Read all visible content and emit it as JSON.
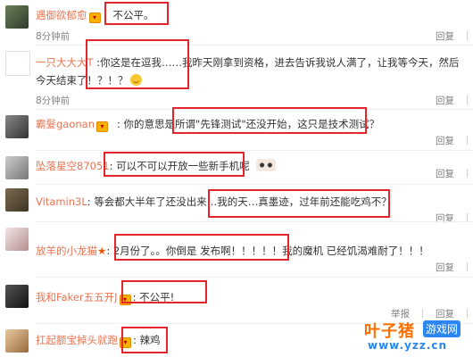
{
  "comments": [
    {
      "user": "遇御欲郁愈",
      "text": "不公平。",
      "time": "8分钟前",
      "actions": [
        "回复"
      ]
    },
    {
      "user": "一只大大大T",
      "text": "你这是在逗我……我昨天刚拿到资格，进去告诉我说人满了，让我等今天，然后今天结束了！？！？",
      "time": "8分钟前",
      "actions": [
        "回复"
      ]
    },
    {
      "user": "霸髮gaonan",
      "text": "你的意思是所谓\"先锋测试\"还没开始，这只是技术测试？",
      "time": "",
      "actions": [
        "回复"
      ]
    },
    {
      "user": "坠落星空87051",
      "text": "可以不可以开放一些新手机呢",
      "time": "",
      "actions": [
        "回复"
      ]
    },
    {
      "user": "Vitamin3L",
      "text": "等会都大半年了还没出来…我的天…真墨迹，过年前还能吃鸡不？",
      "time": "",
      "actions": [
        "回复"
      ]
    },
    {
      "user": "放羊的小龙猫",
      "text": "2月份了。。你倒是 发布啊！！！！！我的魔机 已经饥渴难耐了！！！",
      "time": "",
      "actions": [
        "回复"
      ]
    },
    {
      "user": "我和Faker五五开J",
      "text": "不公平!",
      "time": "",
      "actions": [
        "举报",
        "回复"
      ]
    },
    {
      "user": "扛起额宝掉头就跑",
      "text": "辣鸡",
      "time": "",
      "actions": []
    }
  ],
  "watermark": {
    "main": "叶子猪",
    "sub": "游戏网",
    "url": "www.yzz.cn"
  },
  "colors": {
    "username": "#eb7350",
    "highlight": "#e5252b",
    "time": "#808080"
  }
}
